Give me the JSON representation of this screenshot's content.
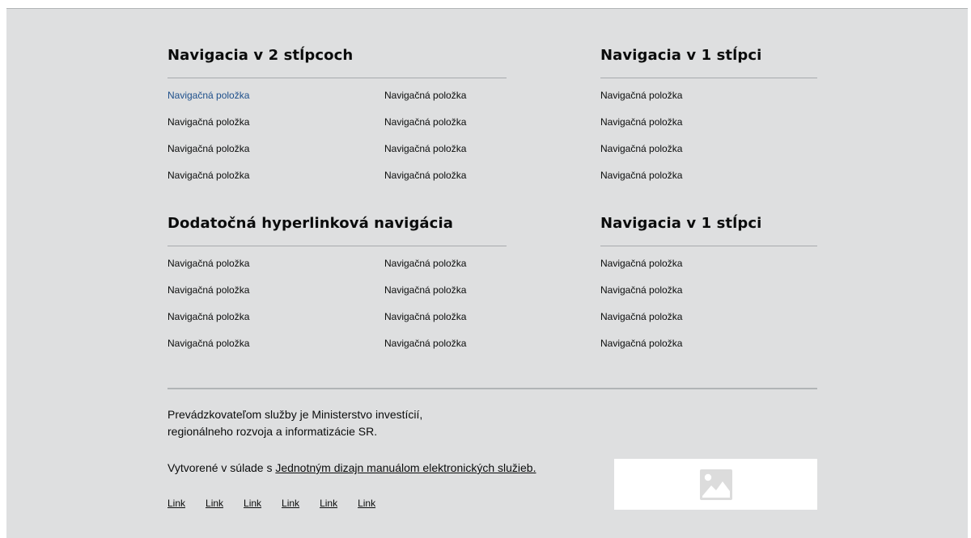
{
  "sections": [
    {
      "title": "Navigacia v 2 stĺpcoch",
      "items": [
        "Navigačná položka",
        "Navigačná položka",
        "Navigačná položka",
        "Navigačná položka",
        "Navigačná položka",
        "Navigačná položka",
        "Navigačná položka",
        "Navigačná položka"
      ]
    },
    {
      "title": "Navigacia  v 1 stĺpci",
      "items": [
        "Navigačná položka",
        "Navigačná položka",
        "Navigačná položka",
        "Navigačná položka"
      ]
    },
    {
      "title": "Dodatočná hyperlinková navigácia",
      "items": [
        "Navigačná položka",
        "Navigačná položka",
        "Navigačná položka",
        "Navigačná položka",
        "Navigačná položka",
        "Navigačná položka",
        "Navigačná položka",
        "Navigačná položka"
      ]
    },
    {
      "title": "Navigacia  v 1 stĺpci",
      "items": [
        "Navigačná položka",
        "Navigačná položka",
        "Navigačná položka",
        "Navigačná položka"
      ]
    }
  ],
  "meta": {
    "operator_line1": "Prevádzkovateľom služby je Ministerstvo investícií,",
    "operator_line2": "regionálneho rozvoja a informatizácie SR.",
    "created_prefix": "Vytvorené v súlade s ",
    "created_link": "Jednotným dizajn manuálom elektronických služieb.",
    "links": [
      "Link",
      "Link",
      "Link",
      "Link",
      "Link",
      "Link"
    ],
    "logo_icon": "image-placeholder-icon"
  },
  "colors": {
    "background": "#dedfe0",
    "active_link": "#1d4f8b",
    "text": "#0b0c0c"
  }
}
